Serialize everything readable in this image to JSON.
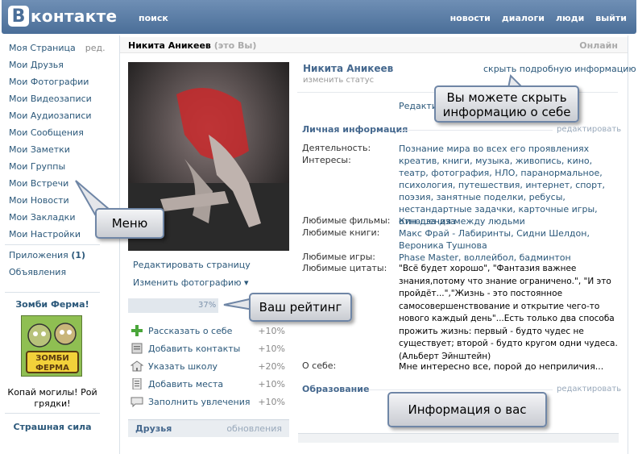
{
  "header": {
    "logo_letter": "В",
    "logo_text": "контакте",
    "search": "поиск",
    "nav": [
      "новости",
      "диалоги",
      "люди",
      "выйти"
    ]
  },
  "menu": {
    "items": [
      "Моя Страница",
      "Мои Друзья",
      "Мои Фотографии",
      "Мои Видеозаписи",
      "Мои Аудиозаписи",
      "Мои Сообщения",
      "Мои Заметки",
      "Мои Группы",
      "Мои Встречи",
      "Мои Новости",
      "Мои Закладки",
      "Мои Настройки"
    ],
    "edit": "ред.",
    "apps_label": "Приложения",
    "apps_count": "(1)",
    "ads": "Объявления"
  },
  "promo": {
    "title": "Зомби Ферма!",
    "caption": "Копай могилы! Рой грядки!",
    "second": "Страшная сила"
  },
  "profile": {
    "name_bar": "Никита Аникеев",
    "you": "(это Вы)",
    "online": "Онлайн",
    "name": "Никита Аникеев",
    "status": "изменить статус",
    "hide_link": "скрыть подробную информацию",
    "edit_info": "Редактировать информацию"
  },
  "left_links": {
    "edit_page": "Редактировать страницу",
    "change_photo": "Изменить фотографию ▾"
  },
  "rating": {
    "percent": "37%",
    "value": 37
  },
  "tasks": [
    {
      "label": "Рассказать о себе",
      "pct": "+10%"
    },
    {
      "label": "Добавить контакты",
      "pct": "+10%"
    },
    {
      "label": "Указать школу",
      "pct": "+20%"
    },
    {
      "label": "Добавить места",
      "pct": "+10%"
    },
    {
      "label": "Заполнить увлечения",
      "pct": "+10%"
    }
  ],
  "friends": {
    "title": "Друзья",
    "updates": "обновления"
  },
  "personal": {
    "title": "Личная информация",
    "edit": "редактировать",
    "rows": [
      {
        "label": "Деятельность:",
        "value": "Познание мира во всех его проявлениях"
      },
      {
        "label": "Интересы:",
        "value": "креатив, книги, музыка, живопись, кино, театр, фотография, НЛО, паранормальное, психология, путешествия, интернет, спорт, поэзия, занятные поделки, ребусы, нестандартные задачки, карточные игры, отношения между людьми"
      },
      {
        "label": "Любимые фильмы:",
        "value": "Кин-дза-дза"
      },
      {
        "label": "Любимые книги:",
        "value": "Макс Фрай - Лабиринты, Сидни Шелдон, Вероника Тушнова"
      },
      {
        "label": "Любимые игры:",
        "value": "Phase Master, воллейбол, бадминтон"
      },
      {
        "label": "Любимые цитаты:",
        "value": "\"Всё будет хорошо\", \"Фантазия важнее знания,потому что знание ограничено.\", \"И это пройдёт...\",\"Жизнь - это постоянное самосовершенствование и открытие чего-то нового каждый день\"...Есть только два способа прожить жизнь: первый - будто чудес не существует; второй - будто кругом одни чудеса. (Альберт Эйнштейн)"
      },
      {
        "label": "О себе:",
        "value": "Мне интересно все, порой до неприличия..."
      }
    ]
  },
  "education": {
    "title": "Образование",
    "edit": "редактировать"
  },
  "callouts": {
    "hide": "Вы можете скрыть информацию о себе",
    "menu": "Меню",
    "rating": "Ваш рейтинг",
    "info": "Информация о вас"
  },
  "colors": {
    "header": "#4a6e98",
    "link": "#2b587a",
    "callout_border": "#6f86a6"
  }
}
